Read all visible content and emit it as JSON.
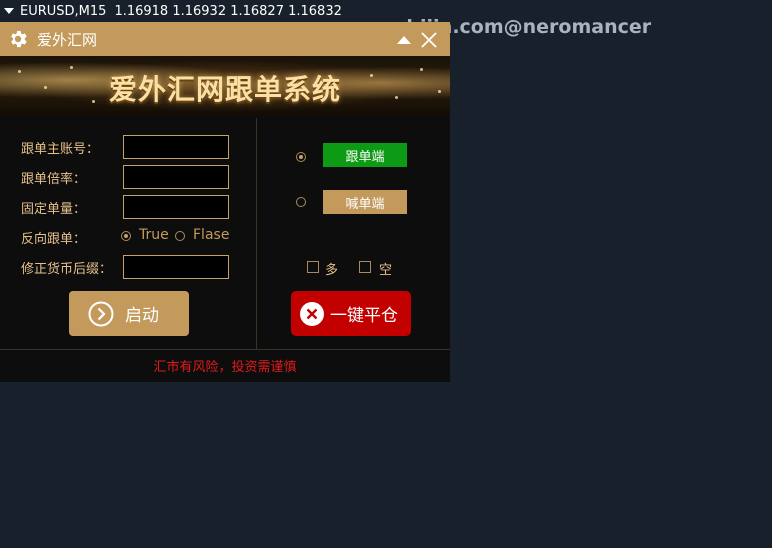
{
  "chart_header": {
    "symbol": "EURUSD,M15",
    "quotes": "1.16918 1.16932 1.16827 1.16832"
  },
  "watermark": "www.eazhijia.com@neromancer",
  "panel": {
    "window_title": "爱外汇网",
    "banner_title": "爱外汇网跟单系统",
    "fields": {
      "master_account_label": "跟单主账号：",
      "master_account_value": "",
      "multiplier_label": "跟单倍率：",
      "multiplier_value": "",
      "fixed_lot_label": "固定单量：",
      "fixed_lot_value": "",
      "reverse_label": "反向跟单：",
      "reverse_true": "True",
      "reverse_false": "Flase",
      "reverse_selected": "True",
      "suffix_label": "修正货币后缀：",
      "suffix_value": ""
    },
    "mode": {
      "follower_label": "跟单端",
      "signal_label": "喊单端",
      "selected": "跟单端"
    },
    "direction": {
      "long_label": "多",
      "short_label": "空",
      "long_checked": false,
      "short_checked": false
    },
    "buttons": {
      "start_label": "启动",
      "close_all_label": "一键平仓"
    },
    "footer_warning": "汇市有风险，投资需谨慎"
  },
  "colors": {
    "gold": "#c39a5b",
    "follower_green": "#0d9a14",
    "close_red": "#c20000",
    "warning_red": "#e01a1a",
    "background": "#18202b"
  }
}
